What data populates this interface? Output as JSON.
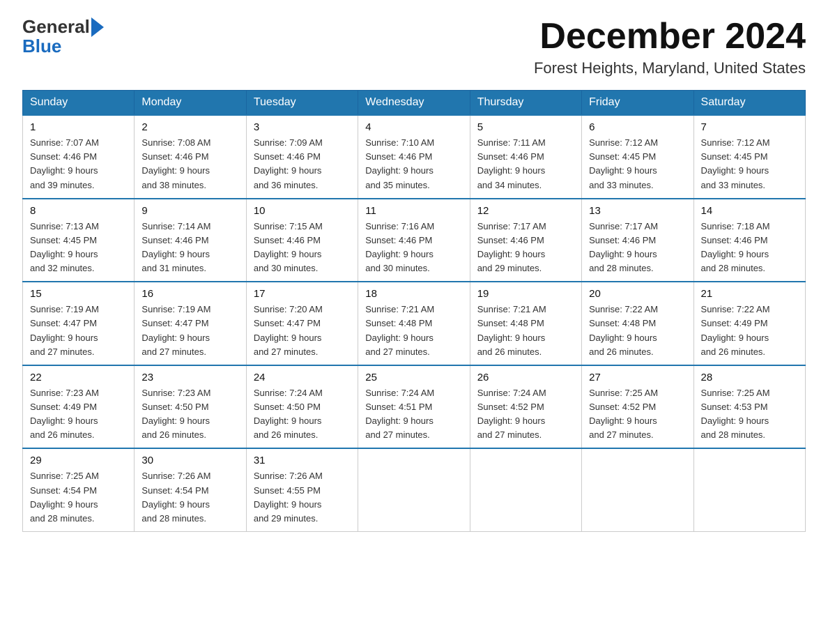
{
  "header": {
    "logo_general": "General",
    "logo_blue": "Blue",
    "month_year": "December 2024",
    "location": "Forest Heights, Maryland, United States"
  },
  "weekdays": [
    "Sunday",
    "Monday",
    "Tuesday",
    "Wednesday",
    "Thursday",
    "Friday",
    "Saturday"
  ],
  "weeks": [
    [
      {
        "day": "1",
        "sunrise": "7:07 AM",
        "sunset": "4:46 PM",
        "daylight": "9 hours and 39 minutes."
      },
      {
        "day": "2",
        "sunrise": "7:08 AM",
        "sunset": "4:46 PM",
        "daylight": "9 hours and 38 minutes."
      },
      {
        "day": "3",
        "sunrise": "7:09 AM",
        "sunset": "4:46 PM",
        "daylight": "9 hours and 36 minutes."
      },
      {
        "day": "4",
        "sunrise": "7:10 AM",
        "sunset": "4:46 PM",
        "daylight": "9 hours and 35 minutes."
      },
      {
        "day": "5",
        "sunrise": "7:11 AM",
        "sunset": "4:46 PM",
        "daylight": "9 hours and 34 minutes."
      },
      {
        "day": "6",
        "sunrise": "7:12 AM",
        "sunset": "4:45 PM",
        "daylight": "9 hours and 33 minutes."
      },
      {
        "day": "7",
        "sunrise": "7:12 AM",
        "sunset": "4:45 PM",
        "daylight": "9 hours and 33 minutes."
      }
    ],
    [
      {
        "day": "8",
        "sunrise": "7:13 AM",
        "sunset": "4:45 PM",
        "daylight": "9 hours and 32 minutes."
      },
      {
        "day": "9",
        "sunrise": "7:14 AM",
        "sunset": "4:46 PM",
        "daylight": "9 hours and 31 minutes."
      },
      {
        "day": "10",
        "sunrise": "7:15 AM",
        "sunset": "4:46 PM",
        "daylight": "9 hours and 30 minutes."
      },
      {
        "day": "11",
        "sunrise": "7:16 AM",
        "sunset": "4:46 PM",
        "daylight": "9 hours and 30 minutes."
      },
      {
        "day": "12",
        "sunrise": "7:17 AM",
        "sunset": "4:46 PM",
        "daylight": "9 hours and 29 minutes."
      },
      {
        "day": "13",
        "sunrise": "7:17 AM",
        "sunset": "4:46 PM",
        "daylight": "9 hours and 28 minutes."
      },
      {
        "day": "14",
        "sunrise": "7:18 AM",
        "sunset": "4:46 PM",
        "daylight": "9 hours and 28 minutes."
      }
    ],
    [
      {
        "day": "15",
        "sunrise": "7:19 AM",
        "sunset": "4:47 PM",
        "daylight": "9 hours and 27 minutes."
      },
      {
        "day": "16",
        "sunrise": "7:19 AM",
        "sunset": "4:47 PM",
        "daylight": "9 hours and 27 minutes."
      },
      {
        "day": "17",
        "sunrise": "7:20 AM",
        "sunset": "4:47 PM",
        "daylight": "9 hours and 27 minutes."
      },
      {
        "day": "18",
        "sunrise": "7:21 AM",
        "sunset": "4:48 PM",
        "daylight": "9 hours and 27 minutes."
      },
      {
        "day": "19",
        "sunrise": "7:21 AM",
        "sunset": "4:48 PM",
        "daylight": "9 hours and 26 minutes."
      },
      {
        "day": "20",
        "sunrise": "7:22 AM",
        "sunset": "4:48 PM",
        "daylight": "9 hours and 26 minutes."
      },
      {
        "day": "21",
        "sunrise": "7:22 AM",
        "sunset": "4:49 PM",
        "daylight": "9 hours and 26 minutes."
      }
    ],
    [
      {
        "day": "22",
        "sunrise": "7:23 AM",
        "sunset": "4:49 PM",
        "daylight": "9 hours and 26 minutes."
      },
      {
        "day": "23",
        "sunrise": "7:23 AM",
        "sunset": "4:50 PM",
        "daylight": "9 hours and 26 minutes."
      },
      {
        "day": "24",
        "sunrise": "7:24 AM",
        "sunset": "4:50 PM",
        "daylight": "9 hours and 26 minutes."
      },
      {
        "day": "25",
        "sunrise": "7:24 AM",
        "sunset": "4:51 PM",
        "daylight": "9 hours and 27 minutes."
      },
      {
        "day": "26",
        "sunrise": "7:24 AM",
        "sunset": "4:52 PM",
        "daylight": "9 hours and 27 minutes."
      },
      {
        "day": "27",
        "sunrise": "7:25 AM",
        "sunset": "4:52 PM",
        "daylight": "9 hours and 27 minutes."
      },
      {
        "day": "28",
        "sunrise": "7:25 AM",
        "sunset": "4:53 PM",
        "daylight": "9 hours and 28 minutes."
      }
    ],
    [
      {
        "day": "29",
        "sunrise": "7:25 AM",
        "sunset": "4:54 PM",
        "daylight": "9 hours and 28 minutes."
      },
      {
        "day": "30",
        "sunrise": "7:26 AM",
        "sunset": "4:54 PM",
        "daylight": "9 hours and 28 minutes."
      },
      {
        "day": "31",
        "sunrise": "7:26 AM",
        "sunset": "4:55 PM",
        "daylight": "9 hours and 29 minutes."
      },
      null,
      null,
      null,
      null
    ]
  ]
}
